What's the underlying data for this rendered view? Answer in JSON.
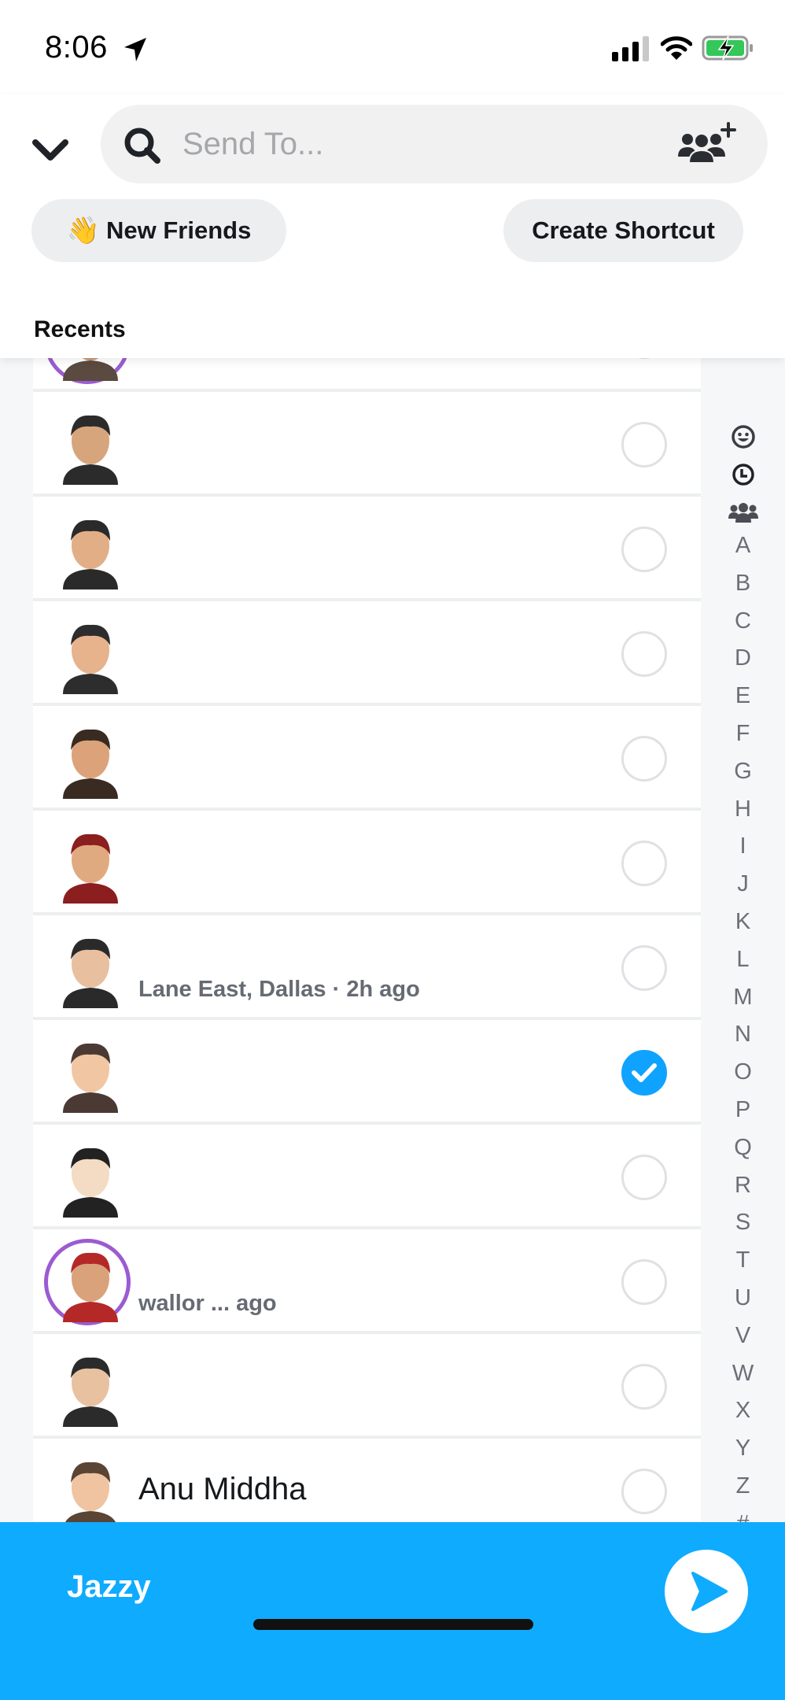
{
  "status_bar": {
    "time": "8:06",
    "icons": [
      "location-arrow-icon",
      "cellular-signal-icon",
      "wifi-icon",
      "battery-charging-icon"
    ],
    "battery_color": "#34c759"
  },
  "header": {
    "back_icon": "chevron-down-icon",
    "search": {
      "placeholder": "Send To...",
      "value": "",
      "icon": "search-icon"
    },
    "add_group_icon": "add-group-icon",
    "new_friends_emoji": "👋",
    "new_friends_label": "New Friends",
    "create_shortcut_label": "Create Shortcut",
    "section_title": "Recents"
  },
  "contacts": [
    {
      "name": "",
      "subtitle": "",
      "selected": false,
      "ring": true
    },
    {
      "name": "",
      "subtitle": "",
      "selected": false,
      "ring": false
    },
    {
      "name": "",
      "subtitle": "",
      "selected": false,
      "ring": false
    },
    {
      "name": "",
      "subtitle": "",
      "selected": false,
      "ring": false
    },
    {
      "name": "",
      "subtitle": "",
      "selected": false,
      "ring": false
    },
    {
      "name": "",
      "subtitle": "",
      "selected": false,
      "ring": false
    },
    {
      "name": "",
      "subtitle": "Lane East, Dallas · 2h ago",
      "selected": false,
      "ring": false
    },
    {
      "name": "",
      "subtitle": "",
      "selected": true,
      "ring": false
    },
    {
      "name": "",
      "subtitle": "",
      "selected": false,
      "ring": false
    },
    {
      "name": "",
      "subtitle": "wallor ... ago",
      "selected": false,
      "ring": true
    },
    {
      "name": "",
      "subtitle": "",
      "selected": false,
      "ring": false
    },
    {
      "name": "Anu Middha",
      "subtitle": "",
      "selected": false,
      "ring": false
    }
  ],
  "index": {
    "icons": [
      "smiley-icon",
      "clock-icon",
      "groups-icon"
    ],
    "letters": [
      "A",
      "B",
      "C",
      "D",
      "E",
      "F",
      "G",
      "H",
      "I",
      "J",
      "K",
      "L",
      "M",
      "N",
      "O",
      "P",
      "Q",
      "R",
      "S",
      "T",
      "U",
      "V",
      "W",
      "X",
      "Y",
      "Z",
      "#"
    ]
  },
  "send_bar": {
    "recipients": "Jazzy",
    "send_icon": "send-arrow-icon",
    "color": "#0fabff"
  },
  "accent_color": "#0fa3ff",
  "ring_color": "#9c5bd1"
}
